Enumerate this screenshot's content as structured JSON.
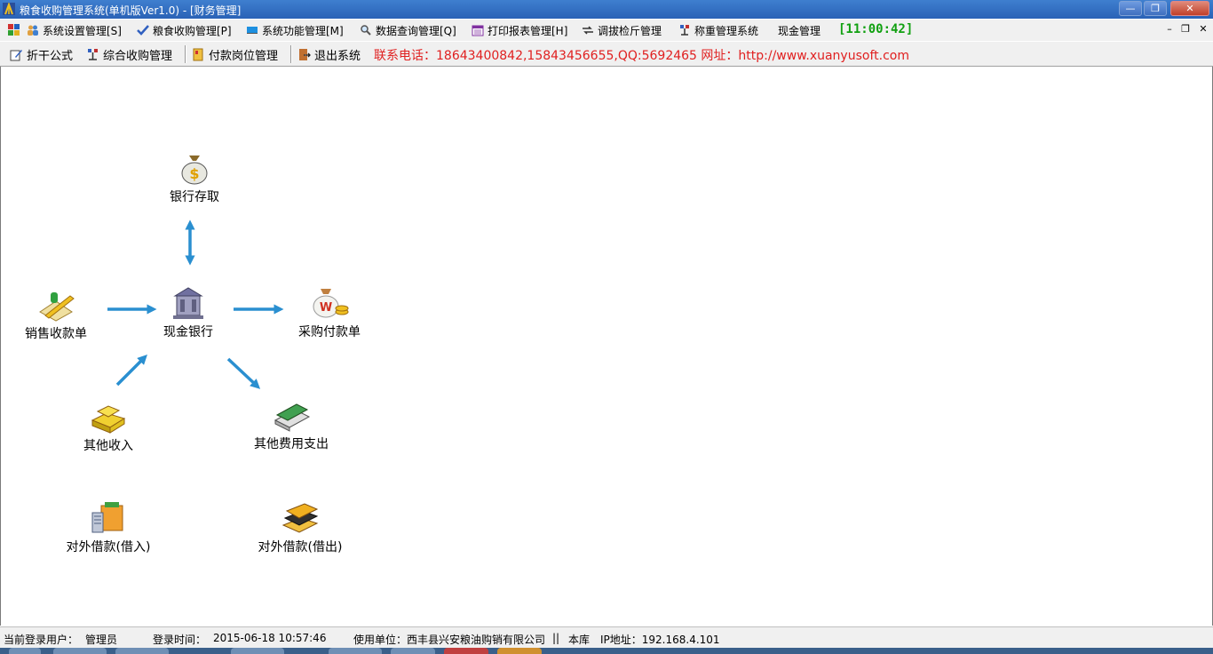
{
  "window": {
    "title": "粮食收购管理系统(单机版Ver1.0) - [财务管理]"
  },
  "menu": {
    "items": [
      {
        "label": "系统设置管理[S]",
        "icon": "users-icon"
      },
      {
        "label": "粮食收购管理[P]",
        "icon": "check-icon"
      },
      {
        "label": "系统功能管理[M]",
        "icon": "monitor-icon"
      },
      {
        "label": "数据查询管理[Q]",
        "icon": "magnifier-icon"
      },
      {
        "label": "打印报表管理[H]",
        "icon": "calendar-icon"
      },
      {
        "label": "调拔检斤管理",
        "icon": "transfer-icon"
      },
      {
        "label": "称重管理系统",
        "icon": "scale-icon"
      },
      {
        "label": "现金管理",
        "icon": ""
      }
    ],
    "clock": "[11:00:42]"
  },
  "toolbar": {
    "items": [
      {
        "label": "折干公式",
        "icon": "edit-icon"
      },
      {
        "label": "综合收购管理",
        "icon": "scale-icon"
      },
      {
        "label": "付款岗位管理",
        "icon": "payment-icon"
      },
      {
        "label": "退出系统",
        "icon": "exit-icon"
      }
    ],
    "contact": "联系电话：18643400842,15843456655,QQ:5692465 网址：http://www.xuanyusoft.com"
  },
  "diagram": {
    "nodes": {
      "bank_deposit": "银行存取",
      "sales_receipt": "销售收款单",
      "cash_bank": "现金银行",
      "purchase_payment": "采购付款单",
      "other_income": "其他收入",
      "other_expense": "其他费用支出",
      "loan_in": "对外借款(借入)",
      "loan_out": "对外借款(借出)"
    },
    "arrow_color": "#2a8fd0"
  },
  "status": {
    "user_label": "当前登录用户：",
    "user": "管理员",
    "login_label": "登录时间：",
    "login_time": "2015-06-18 10:57:46",
    "company": "使用单位：西丰县兴安粮油购销有限公司",
    "sep": "||",
    "db": "本库",
    "ip": "IP地址：192.168.4.101"
  }
}
